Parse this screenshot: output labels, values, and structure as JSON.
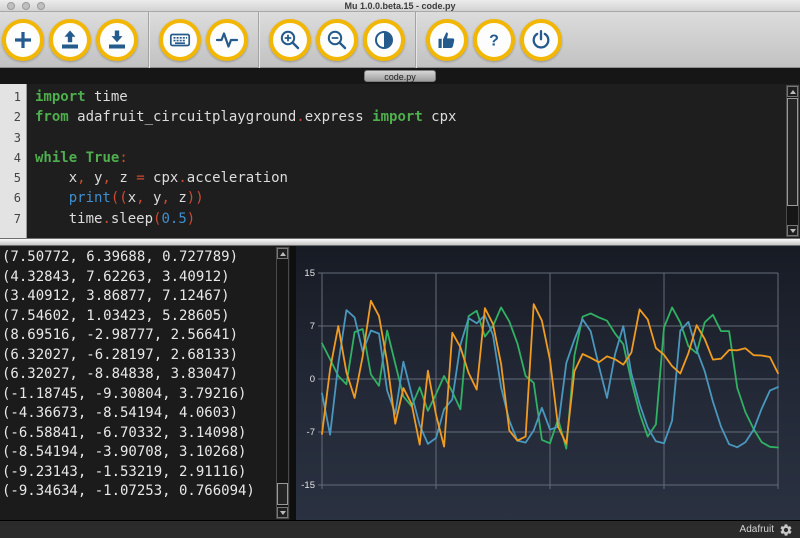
{
  "window": {
    "title": "Mu 1.0.0.beta.15 - code.py"
  },
  "window_controls": {
    "close": "close-window-button",
    "minimize": "minimize-window-button",
    "zoom": "zoom-window-button"
  },
  "toolbar": {
    "groups": [
      [
        {
          "name": "new",
          "icon": "plus-icon"
        },
        {
          "name": "load",
          "icon": "upload-icon"
        },
        {
          "name": "save",
          "icon": "download-icon"
        }
      ],
      [
        {
          "name": "repl",
          "icon": "keyboard-icon"
        },
        {
          "name": "plotter",
          "icon": "pulse-icon"
        }
      ],
      [
        {
          "name": "zoom-in",
          "icon": "zoom-in-icon"
        },
        {
          "name": "zoom-out",
          "icon": "zoom-out-icon"
        },
        {
          "name": "theme",
          "icon": "contrast-icon"
        }
      ],
      [
        {
          "name": "check",
          "icon": "thumbs-up-icon"
        },
        {
          "name": "help",
          "icon": "question-icon"
        },
        {
          "name": "quit",
          "icon": "power-icon"
        }
      ]
    ],
    "accent_ring_color": "#f2b705",
    "icon_color": "#245a8c"
  },
  "tab": {
    "label": "code.py"
  },
  "editor": {
    "lines": [
      {
        "n": "1",
        "tokens": [
          [
            "kw",
            "import"
          ],
          [
            "pl",
            " time"
          ]
        ]
      },
      {
        "n": "2",
        "tokens": [
          [
            "kw",
            "from"
          ],
          [
            "pl",
            " adafruit_circuitplayground"
          ],
          [
            "pu",
            "."
          ],
          [
            "pl",
            "express "
          ],
          [
            "kw",
            "import"
          ],
          [
            "pl",
            " cpx"
          ]
        ]
      },
      {
        "n": "3",
        "tokens": []
      },
      {
        "n": "4",
        "tokens": [
          [
            "kw",
            "while"
          ],
          [
            "pl",
            " "
          ],
          [
            "kw",
            "True"
          ],
          [
            "pu",
            ":"
          ]
        ]
      },
      {
        "n": "5",
        "tokens": [
          [
            "pl",
            "    x"
          ],
          [
            "pu",
            ","
          ],
          [
            "pl",
            " y"
          ],
          [
            "pu",
            ","
          ],
          [
            "pl",
            " z "
          ],
          [
            "pu",
            "="
          ],
          [
            "pl",
            " cpx"
          ],
          [
            "pu",
            "."
          ],
          [
            "pl",
            "acceleration"
          ]
        ]
      },
      {
        "n": "6",
        "tokens": [
          [
            "pl",
            "    "
          ],
          [
            "bi",
            "print"
          ],
          [
            "pu",
            "(("
          ],
          [
            "pl",
            "x"
          ],
          [
            "pu",
            ","
          ],
          [
            "pl",
            " y"
          ],
          [
            "pu",
            ","
          ],
          [
            "pl",
            " z"
          ],
          [
            "pu",
            "))"
          ]
        ]
      },
      {
        "n": "7",
        "tokens": [
          [
            "pl",
            "    time"
          ],
          [
            "pu",
            "."
          ],
          [
            "pl",
            "sleep"
          ],
          [
            "pu",
            "("
          ],
          [
            "nu",
            "0.5"
          ],
          [
            "pu",
            ")"
          ]
        ]
      }
    ],
    "syntax_colors": {
      "keyword": "#4fae4e",
      "plain": "#dcdcdc",
      "punctuation": "#cc4b33",
      "builtin": "#3f8fd0",
      "number": "#3f8fd0"
    }
  },
  "repl": {
    "lines": [
      "(7.50772, 6.39688, 0.727789)",
      "(4.32843, 7.62263, 3.40912)",
      "(3.40912, 3.86877, 7.12467)",
      "(7.54602, 1.03423, 5.28605)",
      "(8.69516, -2.98777, 2.56641)",
      "(6.32027, -6.28197, 2.68133)",
      "(6.32027, -8.84838, 3.83047)",
      "(-1.18745, -9.30804, 3.79216)",
      "(-4.36673, -8.54194, 4.0603)",
      "(-6.58841, -6.70332, 3.14098)",
      "(-8.54194, -3.90708, 3.10268)",
      "(-9.23143, -1.53219, 2.91116)",
      "(-9.34634, -1.07253, 0.766094)"
    ]
  },
  "chart_data": {
    "type": "line",
    "title": "",
    "y_ticks": [
      15,
      7,
      0,
      -7,
      -15
    ],
    "ylim": [
      -15,
      15
    ],
    "grid": true,
    "legend": "none",
    "background": "#1d2330",
    "series": [
      {
        "name": "x",
        "color": "#31b163",
        "values": [
          4.7,
          2.6,
          0.4,
          -0.7,
          6.2,
          6.6,
          0.6,
          -0.9,
          6.4,
          2.0,
          -2.3,
          -3.6,
          -1.1,
          -4.2,
          -2.0,
          0.4,
          -1.7,
          -4.0,
          8.5,
          9.3,
          5.6,
          7.0,
          9.8,
          7.7,
          4.7,
          0.4,
          -0.5,
          -8.2,
          -8.7,
          -5.3,
          -9.5,
          3.1,
          8.4,
          8.9,
          8.3,
          7.8,
          6.0,
          4.6,
          -0.3,
          -4.5,
          -7.7,
          -6.0,
          6.8,
          9.8,
          7.50772,
          4.32843,
          3.40912,
          7.54602,
          8.69516,
          6.32027,
          6.32027,
          -1.18745,
          -4.36673,
          -6.58841,
          -8.54194,
          -9.23143,
          -9.34634
        ]
      },
      {
        "name": "y",
        "color": "#4a97bd",
        "values": [
          -1.9,
          -7.4,
          2.0,
          9.4,
          8.3,
          3.6,
          6.4,
          6.0,
          -1.5,
          -4.6,
          2.3,
          -2.0,
          -6.1,
          -8.8,
          -7.9,
          -4.0,
          -2.7,
          4.5,
          8.2,
          7.4,
          8.6,
          5.8,
          -1.1,
          -5.5,
          -8.3,
          -8.6,
          -6.8,
          -3.8,
          -6.7,
          -6.3,
          2.1,
          5.2,
          8.0,
          6.3,
          1.7,
          -2.5,
          3.3,
          7.0,
          0.7,
          -3.3,
          -6.4,
          -8.4,
          -8.7,
          -5.5,
          6.39688,
          7.62263,
          3.86877,
          1.03423,
          -2.98777,
          -6.28197,
          -8.84838,
          -9.30804,
          -8.54194,
          -6.70332,
          -3.90708,
          -1.53219,
          -1.07253
        ]
      },
      {
        "name": "z",
        "color": "#f09b21",
        "values": [
          -7.3,
          1.3,
          7.0,
          0.9,
          -2.5,
          3.0,
          10.8,
          8.5,
          2.3,
          -5.9,
          -1.2,
          -3.3,
          -8.9,
          1.1,
          -4.7,
          -9.2,
          6.1,
          4.2,
          0.8,
          -1.4,
          9.7,
          7.3,
          2.0,
          -6.8,
          -8.3,
          -7.7,
          10.3,
          7.8,
          2.5,
          -6.3,
          -8.8,
          1.0,
          3.3,
          2.8,
          2.2,
          3.0,
          2.6,
          1.9,
          3.5,
          9.5,
          8.0,
          4.1,
          3.2,
          1.7,
          0.727789,
          3.40912,
          7.12467,
          5.28605,
          2.56641,
          2.68133,
          3.83047,
          3.79216,
          4.0603,
          3.14098,
          3.10268,
          2.91116,
          0.766094
        ]
      }
    ]
  },
  "statusbar": {
    "device": "Adafruit",
    "gear": "gear-icon"
  }
}
